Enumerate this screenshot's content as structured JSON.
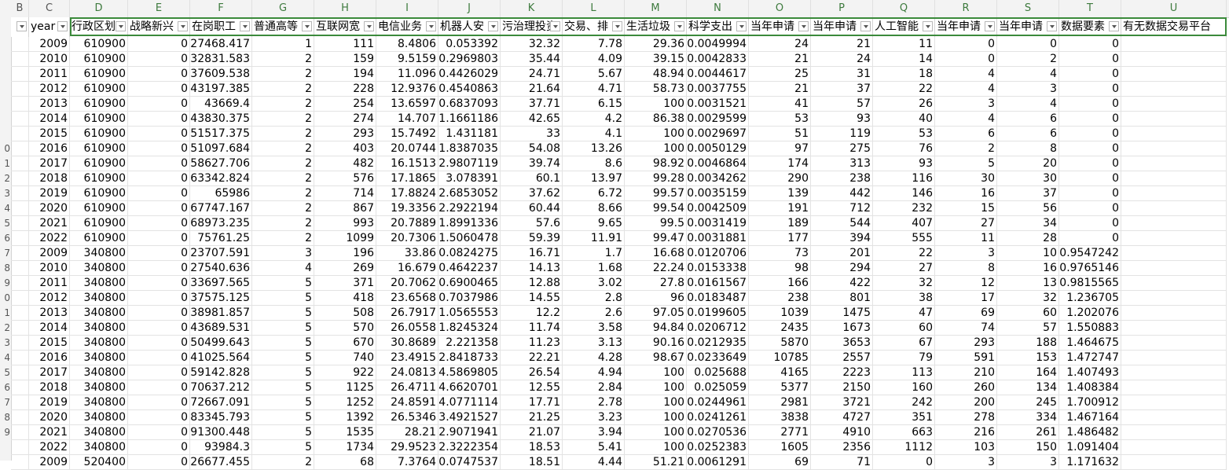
{
  "column_letters": [
    "B",
    "C",
    "D",
    "E",
    "F",
    "G",
    "H",
    "I",
    "J",
    "K",
    "L",
    "M",
    "N",
    "O",
    "P",
    "Q",
    "R",
    "S",
    "T",
    "U"
  ],
  "row_numbers": [
    "",
    "",
    "",
    "",
    "",
    "",
    "",
    "",
    "0",
    "1",
    "2",
    "3",
    "4",
    "5",
    "6",
    "7",
    "8",
    "9",
    "0",
    "1",
    "2",
    "3",
    "4",
    "5",
    "6",
    "7",
    "8",
    "9",
    ""
  ],
  "headers": [
    "",
    "year",
    "行政区划",
    "战略新兴",
    "在岗职工",
    "普通高等",
    "互联网宽",
    "电信业务",
    "机器人安",
    "污治理投资",
    "交易、排",
    "生活垃圾",
    "科学支出",
    "当年申请",
    "当年申请",
    "人工智能",
    "当年申请",
    "当年申请",
    "数据要素",
    "有无数据交易平台"
  ],
  "rows": [
    [
      "",
      "2009",
      "610900",
      "0",
      "27468.417",
      "1",
      "111",
      "8.4806",
      "0.053392",
      "32.32",
      "7.78",
      "29.36",
      "0.0049994",
      "24",
      "21",
      "11",
      "0",
      "0",
      "0",
      ""
    ],
    [
      "",
      "2010",
      "610900",
      "0",
      "32831.583",
      "2",
      "159",
      "9.5159",
      "0.2969803",
      "35.44",
      "4.09",
      "39.15",
      "0.0042833",
      "21",
      "24",
      "14",
      "0",
      "2",
      "0",
      ""
    ],
    [
      "",
      "2011",
      "610900",
      "0",
      "37609.538",
      "2",
      "194",
      "11.096",
      "0.4426029",
      "24.71",
      "5.67",
      "48.94",
      "0.0044617",
      "25",
      "31",
      "18",
      "4",
      "4",
      "0",
      ""
    ],
    [
      "",
      "2012",
      "610900",
      "0",
      "43197.385",
      "2",
      "228",
      "12.9376",
      "0.4540863",
      "21.64",
      "4.71",
      "58.73",
      "0.0037755",
      "21",
      "37",
      "22",
      "4",
      "3",
      "0",
      ""
    ],
    [
      "",
      "2013",
      "610900",
      "0",
      "43669.4",
      "2",
      "254",
      "13.6597",
      "0.6837093",
      "37.71",
      "6.15",
      "100",
      "0.0031521",
      "41",
      "57",
      "26",
      "3",
      "4",
      "0",
      ""
    ],
    [
      "",
      "2014",
      "610900",
      "0",
      "43830.375",
      "2",
      "274",
      "14.707",
      "1.1661186",
      "42.65",
      "4.2",
      "86.38",
      "0.0029599",
      "53",
      "93",
      "40",
      "4",
      "6",
      "0",
      ""
    ],
    [
      "",
      "2015",
      "610900",
      "0",
      "51517.375",
      "2",
      "293",
      "15.7492",
      "1.431181",
      "33",
      "4.1",
      "100",
      "0.0029697",
      "51",
      "119",
      "53",
      "6",
      "6",
      "0",
      ""
    ],
    [
      "",
      "2016",
      "610900",
      "0",
      "51097.684",
      "2",
      "403",
      "20.0744",
      "1.8387035",
      "54.08",
      "13.26",
      "100",
      "0.0050129",
      "97",
      "275",
      "76",
      "2",
      "8",
      "0",
      ""
    ],
    [
      "",
      "2017",
      "610900",
      "0",
      "58627.706",
      "2",
      "482",
      "16.1513",
      "2.9807119",
      "39.74",
      "8.6",
      "98.92",
      "0.0046864",
      "174",
      "313",
      "93",
      "5",
      "20",
      "0",
      ""
    ],
    [
      "",
      "2018",
      "610900",
      "0",
      "63342.824",
      "2",
      "576",
      "17.1865",
      "3.078391",
      "60.1",
      "13.97",
      "99.28",
      "0.0034262",
      "290",
      "238",
      "116",
      "30",
      "30",
      "0",
      ""
    ],
    [
      "",
      "2019",
      "610900",
      "0",
      "65986",
      "2",
      "714",
      "17.8824",
      "2.6853052",
      "37.62",
      "6.72",
      "99.57",
      "0.0035159",
      "139",
      "442",
      "146",
      "16",
      "37",
      "0",
      ""
    ],
    [
      "",
      "2020",
      "610900",
      "0",
      "67747.167",
      "2",
      "867",
      "19.3356",
      "2.2922194",
      "60.44",
      "8.66",
      "99.54",
      "0.0042509",
      "191",
      "712",
      "232",
      "15",
      "56",
      "0",
      ""
    ],
    [
      "",
      "2021",
      "610900",
      "0",
      "68973.235",
      "2",
      "993",
      "20.7889",
      "1.8991336",
      "57.6",
      "9.65",
      "99.5",
      "0.0031419",
      "189",
      "544",
      "407",
      "27",
      "34",
      "0",
      ""
    ],
    [
      "",
      "2022",
      "610900",
      "0",
      "75761.25",
      "2",
      "1099",
      "20.7306",
      "1.5060478",
      "59.39",
      "11.91",
      "99.47",
      "0.0031881",
      "177",
      "394",
      "555",
      "11",
      "28",
      "0",
      ""
    ],
    [
      "",
      "2009",
      "340800",
      "0",
      "23707.591",
      "3",
      "196",
      "33.86",
      "0.0824275",
      "16.71",
      "1.7",
      "16.68",
      "0.0120706",
      "73",
      "201",
      "22",
      "3",
      "10",
      "0.9547242",
      ""
    ],
    [
      "",
      "2010",
      "340800",
      "0",
      "27540.636",
      "4",
      "269",
      "16.679",
      "0.4642237",
      "14.13",
      "1.68",
      "22.24",
      "0.0153338",
      "98",
      "294",
      "27",
      "8",
      "16",
      "0.9765146",
      ""
    ],
    [
      "",
      "2011",
      "340800",
      "0",
      "33697.565",
      "5",
      "371",
      "20.7062",
      "0.6900465",
      "12.88",
      "3.02",
      "27.8",
      "0.0161567",
      "166",
      "422",
      "32",
      "12",
      "13",
      "0.9815565",
      ""
    ],
    [
      "",
      "2012",
      "340800",
      "0",
      "37575.125",
      "5",
      "418",
      "23.6568",
      "0.7037986",
      "14.55",
      "2.8",
      "96",
      "0.0183487",
      "238",
      "801",
      "38",
      "17",
      "32",
      "1.236705",
      ""
    ],
    [
      "",
      "2013",
      "340800",
      "0",
      "38981.857",
      "5",
      "508",
      "26.7917",
      "1.0565553",
      "12.2",
      "2.6",
      "97.05",
      "0.0199605",
      "1039",
      "1475",
      "47",
      "69",
      "60",
      "1.202076",
      ""
    ],
    [
      "",
      "2014",
      "340800",
      "0",
      "43689.531",
      "5",
      "570",
      "26.0558",
      "1.8245324",
      "11.74",
      "3.58",
      "94.84",
      "0.0206712",
      "2435",
      "1673",
      "60",
      "74",
      "57",
      "1.550883",
      ""
    ],
    [
      "",
      "2015",
      "340800",
      "0",
      "50499.643",
      "5",
      "670",
      "30.8689",
      "2.221358",
      "11.23",
      "3.13",
      "90.16",
      "0.0212935",
      "5870",
      "3653",
      "67",
      "293",
      "188",
      "1.464675",
      ""
    ],
    [
      "",
      "2016",
      "340800",
      "0",
      "41025.564",
      "5",
      "740",
      "23.4915",
      "2.8418733",
      "22.21",
      "4.28",
      "98.67",
      "0.0233649",
      "10785",
      "2557",
      "79",
      "591",
      "153",
      "1.472747",
      ""
    ],
    [
      "",
      "2017",
      "340800",
      "0",
      "59142.828",
      "5",
      "922",
      "24.0813",
      "4.5869805",
      "26.54",
      "4.94",
      "100",
      "0.025688",
      "4165",
      "2223",
      "113",
      "210",
      "164",
      "1.407493",
      ""
    ],
    [
      "",
      "2018",
      "340800",
      "0",
      "70637.212",
      "5",
      "1125",
      "26.4711",
      "4.6620701",
      "12.55",
      "2.84",
      "100",
      "0.025059",
      "5377",
      "2150",
      "160",
      "260",
      "134",
      "1.408384",
      ""
    ],
    [
      "",
      "2019",
      "340800",
      "0",
      "72667.091",
      "5",
      "1252",
      "24.8591",
      "4.0771114",
      "17.71",
      "2.78",
      "100",
      "0.0244961",
      "2981",
      "3721",
      "242",
      "200",
      "245",
      "1.700912",
      ""
    ],
    [
      "",
      "2020",
      "340800",
      "0",
      "83345.793",
      "5",
      "1392",
      "26.5346",
      "3.4921527",
      "21.25",
      "3.23",
      "100",
      "0.0241261",
      "3838",
      "4727",
      "351",
      "278",
      "334",
      "1.467164",
      ""
    ],
    [
      "",
      "2021",
      "340800",
      "0",
      "91300.448",
      "5",
      "1535",
      "28.21",
      "2.9071941",
      "21.07",
      "3.94",
      "100",
      "0.0270536",
      "2771",
      "4910",
      "663",
      "216",
      "261",
      "1.486482",
      ""
    ],
    [
      "",
      "2022",
      "340800",
      "0",
      "93984.3",
      "5",
      "1734",
      "29.9523",
      "2.3222354",
      "18.53",
      "5.41",
      "100",
      "0.0252383",
      "1605",
      "2356",
      "1112",
      "103",
      "150",
      "1.091404",
      ""
    ],
    [
      "",
      "2009",
      "520400",
      "0",
      "26677.455",
      "2",
      "68",
      "7.3764",
      "0.0747537",
      "18.51",
      "4.44",
      "51.21",
      "0.0061291",
      "69",
      "71",
      "0",
      "3",
      "3",
      "1.171632",
      ""
    ]
  ]
}
